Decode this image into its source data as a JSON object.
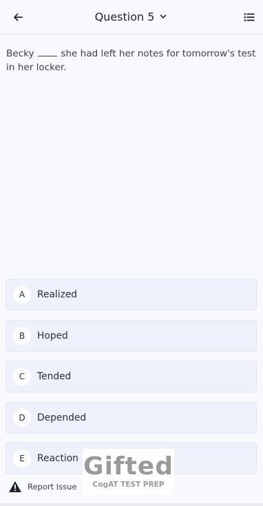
{
  "header": {
    "title": "Question 5",
    "back_icon": "arrow-left-icon",
    "dropdown_icon": "chevron-down-icon",
    "list_icon": "list-icon"
  },
  "question": {
    "text_before": "Becky",
    "text_after": "she had left her notes for tomorrow's test in her locker."
  },
  "options": [
    {
      "letter": "A",
      "label": "Realized"
    },
    {
      "letter": "B",
      "label": "Hoped"
    },
    {
      "letter": "C",
      "label": "Tended"
    },
    {
      "letter": "D",
      "label": "Depended"
    },
    {
      "letter": "E",
      "label": "Reaction"
    }
  ],
  "footer": {
    "report_label": "Report Issue",
    "report_icon": "warning-icon"
  },
  "watermark": {
    "logo": "Gifted",
    "subtitle": "CogAT TEST PREP"
  },
  "colors": {
    "background": "#f8f9fc",
    "option_bg": "#eef1fb",
    "text": "#1f2330"
  }
}
